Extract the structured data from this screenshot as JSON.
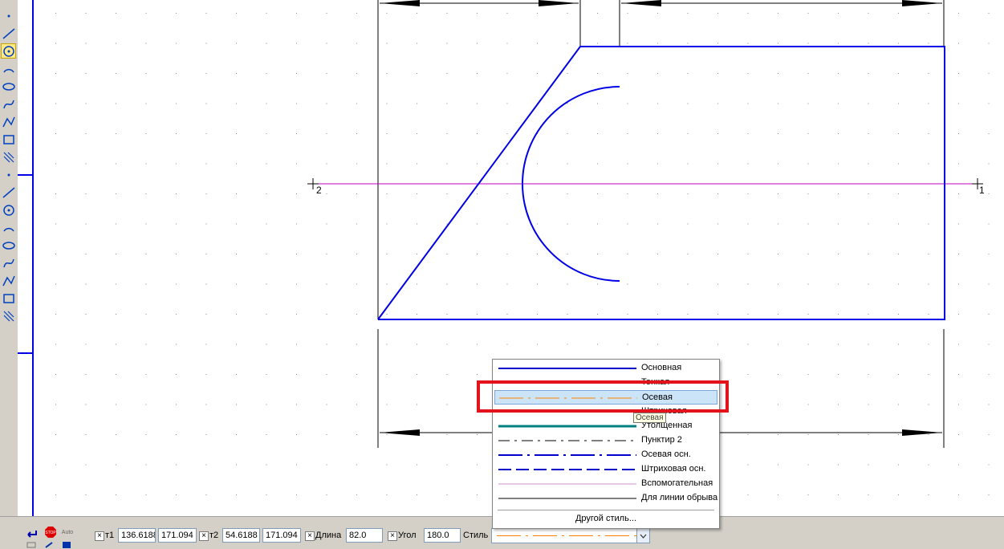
{
  "toolbar_left": {
    "tools": [
      "point-icon",
      "auxiliary-line-icon",
      "segment-icon",
      "circle-icon",
      "arc-icon",
      "ellipse-icon",
      "bezier-icon",
      "spline-icon",
      "polyline-icon",
      "nurbs-icon",
      "chamfer-icon",
      "fillet-icon",
      "rectangle-icon",
      "polygon-icon",
      "hatch-icon",
      "fill-icon",
      "equidistant-icon",
      "contour-icon"
    ]
  },
  "drawing": {
    "point_labels": [
      "2",
      "1"
    ],
    "colors": {
      "main_line": "#0000e6",
      "auxiliary": "#c000c0",
      "dimension": "#000000",
      "grid": "#888888"
    }
  },
  "style_dropdown": {
    "items": [
      {
        "name": "Основная",
        "color": "#0000cc",
        "pattern": "solid",
        "width": 2
      },
      {
        "name": "Тонкая",
        "color": "#000000",
        "pattern": "solid",
        "width": 1
      },
      {
        "name": "Осевая",
        "color": "#ff8000",
        "pattern": "dashdot",
        "width": 1,
        "selected": true
      },
      {
        "name": "Штриховая",
        "color": "#000000",
        "pattern": "dash",
        "width": 1
      },
      {
        "name": "Утолщенная",
        "color": "#008080",
        "pattern": "solid",
        "width": 3
      },
      {
        "name": "Пунктир 2",
        "color": "#000000",
        "pattern": "dashdot2",
        "width": 1
      },
      {
        "name": "Осевая осн.",
        "color": "#0000cc",
        "pattern": "dashdot",
        "width": 2
      },
      {
        "name": "Штриховая осн.",
        "color": "#0000cc",
        "pattern": "dash",
        "width": 2
      },
      {
        "name": "Вспомогательная",
        "color": "#d090d0",
        "pattern": "solid",
        "width": 1
      },
      {
        "name": "Для линии обрыва",
        "color": "#000000",
        "pattern": "solid",
        "width": 1
      }
    ],
    "other_style": "Другой стиль...",
    "tooltip": "Осевая"
  },
  "properties": {
    "t1_label": "т1",
    "t1_x": "136.6188",
    "t1_y": "171.094",
    "t2_label": "т2",
    "t2_x": "54.6188",
    "t2_y": "171.094",
    "length_label": "Длина",
    "length_value": "82.0",
    "angle_label": "Угол",
    "angle_value": "180.0",
    "style_label": "Стиль",
    "check_mark": "×",
    "stop_label": "STOP",
    "auto_label": "Auto"
  }
}
